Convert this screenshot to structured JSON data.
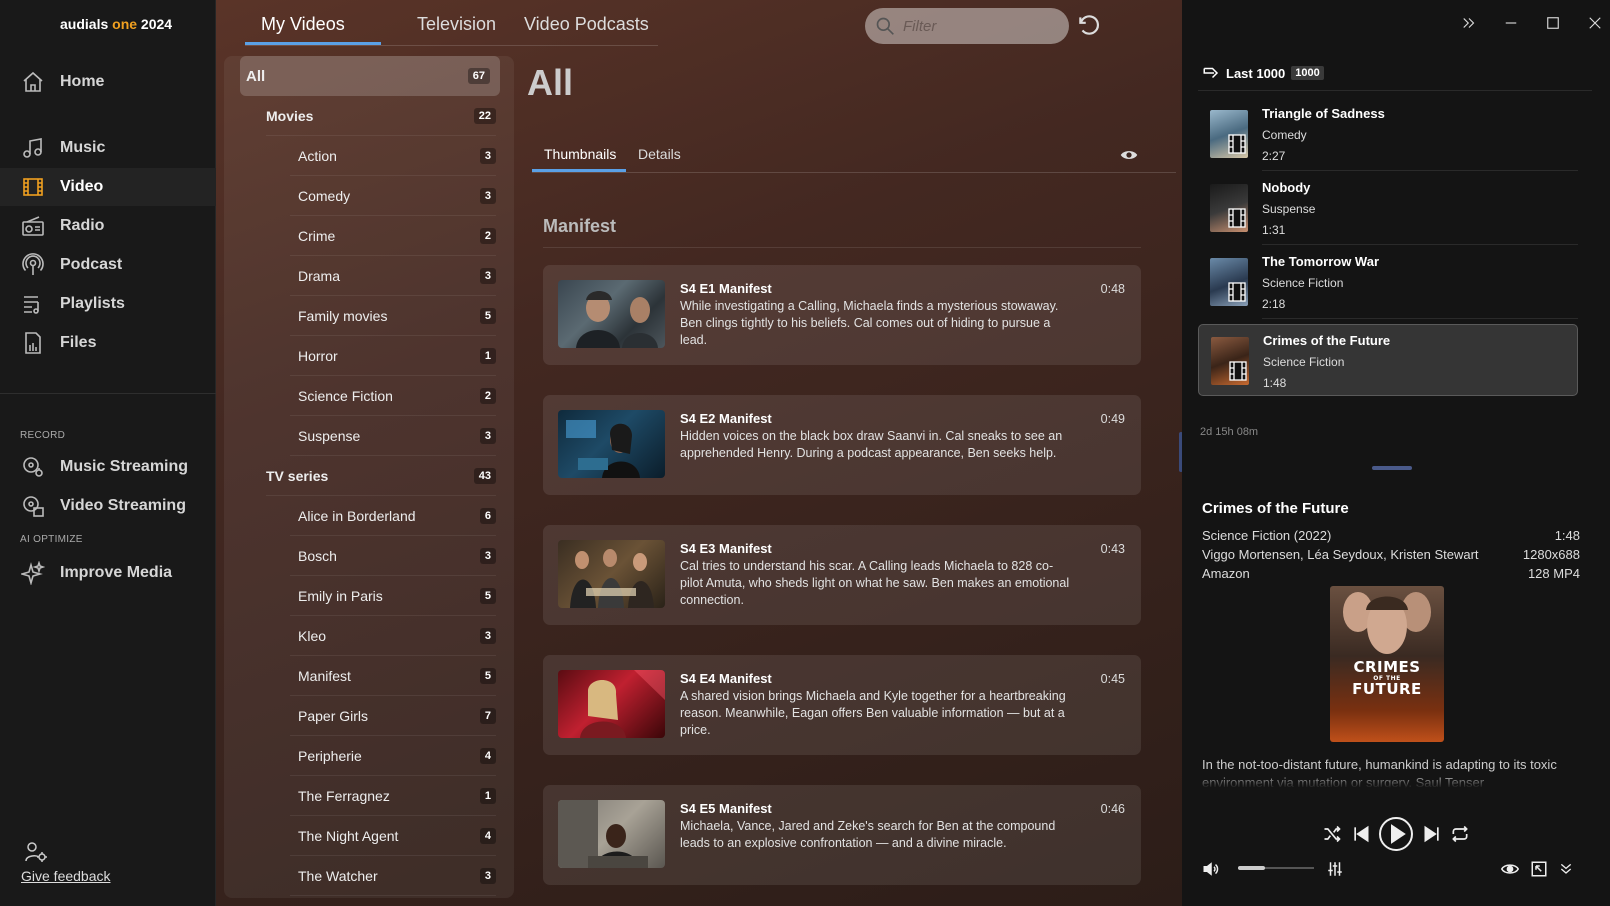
{
  "app": {
    "logo_prefix": "audials ",
    "logo_accent": "one",
    "logo_suffix": " 2024"
  },
  "nav": {
    "items": [
      {
        "label": "Home",
        "icon": "home-icon"
      },
      {
        "label": "Music",
        "icon": "music-icon"
      },
      {
        "label": "Video",
        "icon": "video-icon"
      },
      {
        "label": "Radio",
        "icon": "radio-icon"
      },
      {
        "label": "Podcast",
        "icon": "podcast-icon"
      },
      {
        "label": "Playlists",
        "icon": "playlists-icon"
      },
      {
        "label": "Files",
        "icon": "files-icon"
      }
    ],
    "record_section": "RECORD",
    "record_items": [
      {
        "label": "Music Streaming",
        "icon": "music-streaming-icon"
      },
      {
        "label": "Video Streaming",
        "icon": "video-streaming-icon"
      }
    ],
    "ai_section": "AI OPTIMIZE",
    "ai_items": [
      {
        "label": "Improve Media",
        "icon": "sparkle-icon"
      }
    ],
    "feedback": "Give feedback"
  },
  "top_tabs": [
    "My Videos",
    "Television",
    "Video Podcasts"
  ],
  "filter": {
    "placeholder": "Filter"
  },
  "categories": {
    "all": {
      "label": "All",
      "count": "67"
    },
    "movies": {
      "label": "Movies",
      "count": "22",
      "items": [
        {
          "label": "Action",
          "count": "3"
        },
        {
          "label": "Comedy",
          "count": "3"
        },
        {
          "label": "Crime",
          "count": "2"
        },
        {
          "label": "Drama",
          "count": "3"
        },
        {
          "label": "Family movies",
          "count": "5"
        },
        {
          "label": "Horror",
          "count": "1"
        },
        {
          "label": "Science Fiction",
          "count": "2"
        },
        {
          "label": "Suspense",
          "count": "3"
        }
      ]
    },
    "tv": {
      "label": "TV series",
      "count": "43",
      "items": [
        {
          "label": "Alice in Borderland",
          "count": "6"
        },
        {
          "label": "Bosch",
          "count": "3"
        },
        {
          "label": "Emily in Paris",
          "count": "5"
        },
        {
          "label": "Kleo",
          "count": "3"
        },
        {
          "label": "Manifest",
          "count": "5"
        },
        {
          "label": "Paper Girls",
          "count": "7"
        },
        {
          "label": "Peripherie",
          "count": "4"
        },
        {
          "label": "The Ferragnez",
          "count": "1"
        },
        {
          "label": "The Night Agent",
          "count": "4"
        },
        {
          "label": "The Watcher",
          "count": "3"
        }
      ]
    }
  },
  "content": {
    "title": "All",
    "view_tabs": [
      "Thumbnails",
      "Details"
    ],
    "section": "Manifest",
    "episodes": [
      {
        "title": "S4 E1 Manifest",
        "duration": "0:48",
        "desc": "While investigating a Calling, Michaela finds a mysterious stowaway. Ben clings tightly to his beliefs. Cal comes out of hiding to pursue a lead."
      },
      {
        "title": "S4 E2 Manifest",
        "duration": "0:49",
        "desc": "Hidden voices on the black box draw Saanvi in. Cal sneaks to see an apprehended Henry. During a podcast appearance, Ben seeks help."
      },
      {
        "title": "S4 E3 Manifest",
        "duration": "0:43",
        "desc": "Cal tries to understand his scar. A Calling leads Michaela to 828 co-pilot Amuta, who sheds light on what he saw. Ben makes an emotional connection."
      },
      {
        "title": "S4 E4 Manifest",
        "duration": "0:45",
        "desc": "A shared vision brings Michaela and Kyle together for a heartbreaking reason. Meanwhile, Eagan offers Ben valuable information — but at a price."
      },
      {
        "title": "S4 E5 Manifest",
        "duration": "0:46",
        "desc": "Michaela, Vance, Jared and Zeke's search for Ben at the compound leads to an explosive confrontation — and a divine miracle."
      }
    ]
  },
  "history": {
    "label": "Last 1000",
    "badge": "1000",
    "items": [
      {
        "title": "Triangle of Sadness",
        "genre": "Comedy",
        "duration": "2:27"
      },
      {
        "title": "Nobody",
        "genre": "Suspense",
        "duration": "1:31"
      },
      {
        "title": "The Tomorrow War",
        "genre": "Science Fiction",
        "duration": "2:18"
      },
      {
        "title": "Crimes of the Future",
        "genre": "Science Fiction",
        "duration": "1:48"
      }
    ],
    "total": "2d 15h 08m"
  },
  "details": {
    "title": "Crimes of the Future",
    "genre_year": "Science Fiction (2022)",
    "duration": "1:48",
    "cast": "Viggo Mortensen, Léa Seydoux, Kristen Stewart",
    "resolution": "1280x688",
    "source": "Amazon",
    "size_format": "128 MP4",
    "poster_line1": "CRIMES",
    "poster_line2": "OF THE",
    "poster_line3": "FUTURE",
    "description": "In the not-too-distant future, humankind is adapting to its toxic environment via mutation or surgery. Saul Tenser"
  },
  "player": {
    "volume": 0.35
  }
}
